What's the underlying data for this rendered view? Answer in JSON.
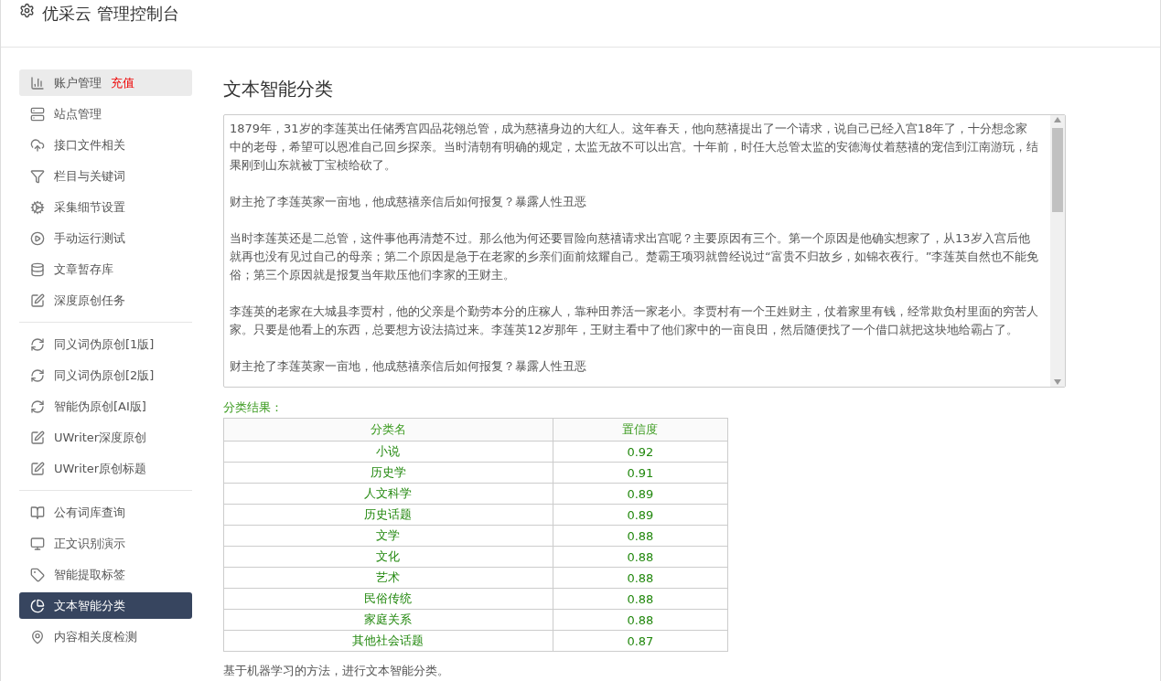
{
  "header": {
    "title": "优采云 管理控制台"
  },
  "sidebar": {
    "groups": [
      [
        {
          "label": "账户管理",
          "badge": "充值",
          "selected": false,
          "hovered": true
        },
        {
          "label": "站点管理",
          "selected": false,
          "hovered": false
        },
        {
          "label": "接口文件相关",
          "selected": false,
          "hovered": false
        },
        {
          "label": "栏目与关键词",
          "selected": false,
          "hovered": false
        },
        {
          "label": "采集细节设置",
          "selected": false,
          "hovered": false
        },
        {
          "label": "手动运行测试",
          "selected": false,
          "hovered": false
        },
        {
          "label": "文章暂存库",
          "selected": false,
          "hovered": false
        },
        {
          "label": "深度原创任务",
          "selected": false,
          "hovered": false
        }
      ],
      [
        {
          "label": "同义词伪原创[1版]",
          "selected": false,
          "hovered": false
        },
        {
          "label": "同义词伪原创[2版]",
          "selected": false,
          "hovered": false
        },
        {
          "label": "智能伪原创[AI版]",
          "selected": false,
          "hovered": false
        },
        {
          "label": "UWriter深度原创",
          "selected": false,
          "hovered": false
        },
        {
          "label": "UWriter原创标题",
          "selected": false,
          "hovered": false
        }
      ],
      [
        {
          "label": "公有词库查询",
          "selected": false,
          "hovered": false
        },
        {
          "label": "正文识别演示",
          "selected": false,
          "hovered": false
        },
        {
          "label": "智能提取标签",
          "selected": false,
          "hovered": false
        },
        {
          "label": "文本智能分类",
          "selected": true,
          "hovered": false
        },
        {
          "label": "内容相关度检测",
          "selected": false,
          "hovered": false
        }
      ]
    ]
  },
  "main": {
    "title": "文本智能分类",
    "text_area": {
      "paragraphs": [
        "1879年，31岁的李莲英出任储秀宫四品花翎总管，成为慈禧身边的大红人。这年春天，他向慈禧提出了一个请求，说自己已经入宫18年了，十分想念家中的老母，希望可以恩准自己回乡探亲。当时清朝有明确的规定，太监无故不可以出宫。十年前，时任大总管太监的安德海仗着慈禧的宠信到江南游玩，结果刚到山东就被丁宝桢给砍了。",
        "财主抢了李莲英家一亩地，他成慈禧亲信后如何报复？暴露人性丑恶",
        "当时李莲英还是二总管，这件事他再清楚不过。那么他为何还要冒险向慈禧请求出宫呢？主要原因有三个。第一个原因是他确实想家了，从13岁入宫后他就再也没有见过自己的母亲；第二个原因是急于在老家的乡亲们面前炫耀自己。楚霸王项羽就曾经说过“富贵不归故乡，如锦衣夜行。”李莲英自然也不能免俗；第三个原因就是报复当年欺压他们李家的王财主。",
        "李莲英的老家在大城县李贾村，他的父亲是个勤劳本分的庄稼人，靠种田养活一家老小。李贾村有一个王姓财主，仗着家里有钱，经常欺负村里面的穷苦人家。只要是他看上的东西，总要想方设法搞过来。李莲英12岁那年，王财主看中了他们家中的一亩良田，然后随便找了一个借口就把这块地给霸占了。",
        "财主抢了李莲英家一亩地，他成慈禧亲信后如何报复？暴露人性丑恶"
      ]
    },
    "result_label": "分类结果：",
    "table": {
      "columns": [
        "分类名",
        "置信度"
      ],
      "rows": [
        [
          "小说",
          "0.92"
        ],
        [
          "历史学",
          "0.91"
        ],
        [
          "人文科学",
          "0.89"
        ],
        [
          "历史话题",
          "0.89"
        ],
        [
          "文学",
          "0.88"
        ],
        [
          "文化",
          "0.88"
        ],
        [
          "艺术",
          "0.88"
        ],
        [
          "民俗传统",
          "0.88"
        ],
        [
          "家庭关系",
          "0.88"
        ],
        [
          "其他社会话题",
          "0.87"
        ]
      ]
    },
    "footnote": "基于机器学习的方法，进行文本智能分类。"
  }
}
